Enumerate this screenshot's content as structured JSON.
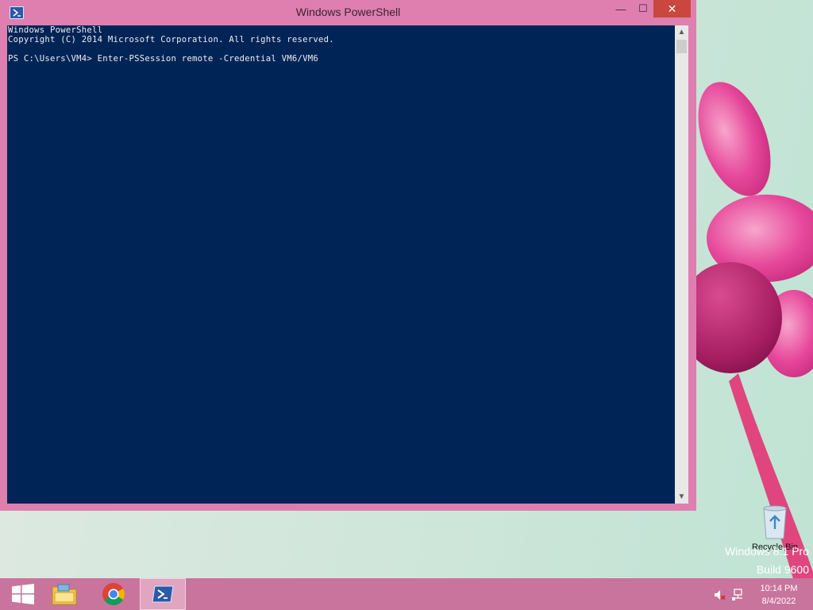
{
  "window": {
    "title": "Windows PowerShell",
    "icon": "powershell-icon",
    "minimize_glyph": "—",
    "maximize_glyph": "☐",
    "close_glyph": "✕"
  },
  "console": {
    "lines": [
      "Windows PowerShell",
      "Copyright (C) 2014 Microsoft Corporation. All rights reserved.",
      "",
      "PS C:\\Users\\VM4> Enter-PSSession remote -Credential VM6/VM6"
    ],
    "background": "#012456",
    "foreground": "#eeedf0"
  },
  "desktop": {
    "recycle_bin_label": "Recycle Bin",
    "watermark_line1": "Windows 8.1 Pro",
    "watermark_line2": "Build 9600"
  },
  "taskbar": {
    "items": [
      "start-button",
      "file-explorer",
      "google-chrome",
      "windows-powershell"
    ],
    "active_item": "windows-powershell",
    "time": "10:14 PM",
    "date": "8/4/2022",
    "tray_icons": [
      "volume-muted-icon",
      "network-icon"
    ]
  },
  "colors": {
    "window_frame": "#de7fb0",
    "taskbar": "#c9749c",
    "close_button": "#c9473e"
  }
}
